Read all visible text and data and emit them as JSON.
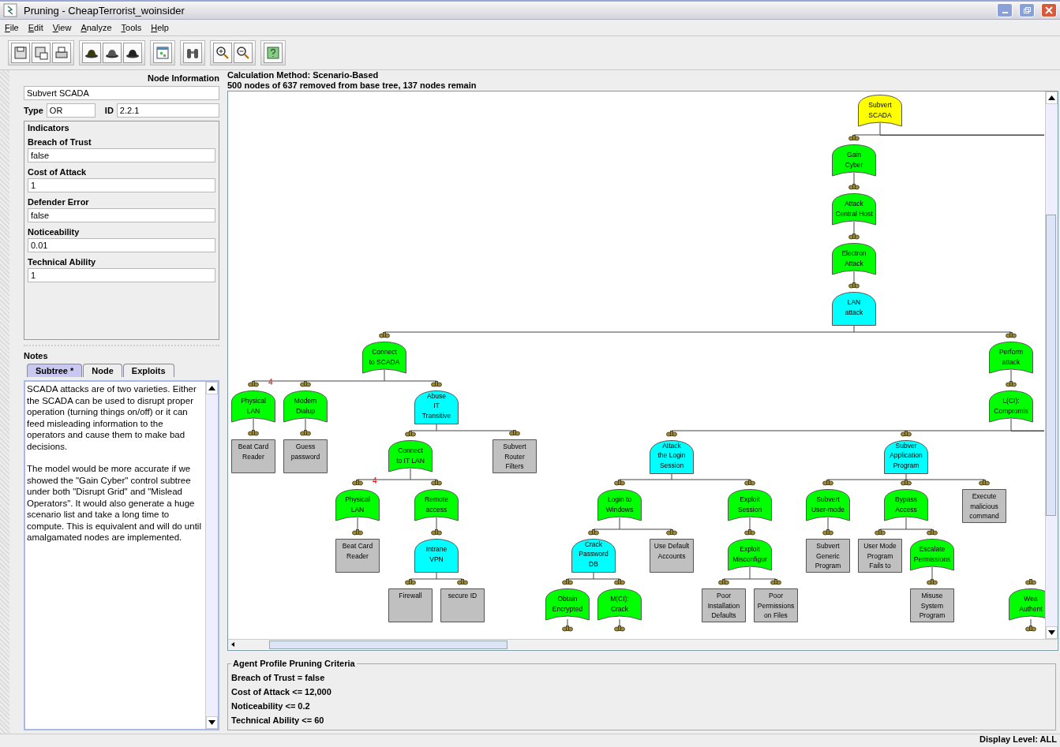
{
  "window": {
    "title": "Pruning - CheapTerrorist_woinsider"
  },
  "menu": [
    "File",
    "Edit",
    "View",
    "Analyze",
    "Tools",
    "Help"
  ],
  "node_info": {
    "title": "Node Information",
    "name": "Subvert SCADA",
    "type_label": "Type",
    "type": "OR",
    "id_label": "ID",
    "id": "2.2.1",
    "indicators_title": "Indicators",
    "indicators": [
      {
        "label": "Breach of Trust",
        "value": "false"
      },
      {
        "label": "Cost of Attack",
        "value": "1"
      },
      {
        "label": "Defender Error",
        "value": "false"
      },
      {
        "label": "Noticeability",
        "value": "0.01"
      },
      {
        "label": "Technical Ability",
        "value": "1"
      }
    ]
  },
  "notes": {
    "title": "Notes",
    "tabs": [
      {
        "label": "Subtree *",
        "selected": true
      },
      {
        "label": "Node",
        "selected": false
      },
      {
        "label": "Exploits",
        "selected": false
      }
    ],
    "paragraphs": [
      "SCADA attacks are of two varieties. Either the SCADA can be used to disrupt proper operation (turning things on/off) or it can feed misleading information to the operators and cause them to make bad decisions.",
      "The model would be more accurate if we showed the \"Gain Cyber\" control subtree under both \"Disrupt Grid\" and \"Mislead Operators\".  It would also generate a huge scenario list and take a long time to compute.  This is equivalent and will do until amalgamated nodes are implemented."
    ]
  },
  "calculation_method": "Calculation Method: Scenario-Based",
  "summary": "500 nodes of 637 removed from base tree, 137 nodes remain",
  "tree": {
    "lines": [
      "Subvert",
      "SCADA"
    ],
    "kind": "or",
    "selected": true,
    "more_right": true,
    "children": [
      {
        "lines": [
          "Gain",
          "Cyber"
        ],
        "kind": "or",
        "children": [
          {
            "lines": [
              "Attack",
              "Central Host"
            ],
            "kind": "or",
            "children": [
              {
                "lines": [
                  "Electron",
                  "Attack"
                ],
                "kind": "or",
                "children": [
                  {
                    "lines": [
                      "LAN",
                      "attack"
                    ],
                    "kind": "and",
                    "children": [
                      {
                        "lines": [
                          "Connect",
                          "to SCADA"
                        ],
                        "kind": "or",
                        "children": [
                          {
                            "lines": [
                              "Physical",
                              "LAN"
                            ],
                            "kind": "or",
                            "badge": "4",
                            "children": [
                              {
                                "lines": [
                                  "Beat Card",
                                  "Reader"
                                ],
                                "kind": "leaf"
                              }
                            ]
                          },
                          {
                            "lines": [
                              "Modem",
                              "Dialup"
                            ],
                            "kind": "or",
                            "children": [
                              {
                                "lines": [
                                  "Guess",
                                  "password"
                                ],
                                "kind": "leaf"
                              }
                            ]
                          },
                          {
                            "lines": [
                              "Abuse",
                              "IT",
                              "Transitive"
                            ],
                            "kind": "and",
                            "children": [
                              {
                                "lines": [
                                  "Connect",
                                  "to IT LAN"
                                ],
                                "kind": "or",
                                "children": [
                                  {
                                    "lines": [
                                      "Physical",
                                      "LAN"
                                    ],
                                    "kind": "or",
                                    "badge": "4",
                                    "children": [
                                      {
                                        "lines": [
                                          "Beat Card",
                                          "Reader"
                                        ],
                                        "kind": "leaf"
                                      }
                                    ]
                                  },
                                  {
                                    "lines": [
                                      "Remote",
                                      "access"
                                    ],
                                    "kind": "or",
                                    "children": [
                                      {
                                        "lines": [
                                          "Intrane",
                                          "VPN"
                                        ],
                                        "kind": "and",
                                        "children": [
                                          {
                                            "lines": [
                                              "Firewall"
                                            ],
                                            "kind": "leaf"
                                          },
                                          {
                                            "lines": [
                                              "secure ID"
                                            ],
                                            "kind": "leaf"
                                          }
                                        ]
                                      }
                                    ]
                                  }
                                ]
                              },
                              {
                                "lines": [
                                  "Subvert",
                                  "Router",
                                  "Filters"
                                ],
                                "kind": "leaf"
                              }
                            ]
                          }
                        ]
                      },
                      {
                        "lines": [
                          "Perform",
                          "attack"
                        ],
                        "kind": "or",
                        "children": [
                          {
                            "lines": [
                              "L(CI):",
                              "Compromis"
                            ],
                            "kind": "or",
                            "more_right": true,
                            "children": [
                              {
                                "lines": [
                                  "Attack",
                                  "the Login",
                                  "Session"
                                ],
                                "kind": "and",
                                "children": [
                                  {
                                    "lines": [
                                      "Login to",
                                      "Windows"
                                    ],
                                    "kind": "or",
                                    "children": [
                                      {
                                        "lines": [
                                          "Crack",
                                          "Password",
                                          "DB"
                                        ],
                                        "kind": "and",
                                        "children": [
                                          {
                                            "lines": [
                                              "Obtain",
                                              "Encrypted"
                                            ],
                                            "kind": "or",
                                            "more_below": true
                                          },
                                          {
                                            "lines": [
                                              "M(CI):",
                                              "Crack"
                                            ],
                                            "kind": "or",
                                            "more_below": true
                                          }
                                        ]
                                      },
                                      {
                                        "lines": [
                                          "Use Default",
                                          "Accounts"
                                        ],
                                        "kind": "leaf"
                                      }
                                    ]
                                  },
                                  {
                                    "lines": [
                                      "Exploit",
                                      "Session"
                                    ],
                                    "kind": "or",
                                    "children": [
                                      {
                                        "lines": [
                                          "Exploit",
                                          "Misconfigur"
                                        ],
                                        "kind": "or",
                                        "children": [
                                          {
                                            "lines": [
                                              "Poor",
                                              "Installation",
                                              "Defaults"
                                            ],
                                            "kind": "leaf"
                                          },
                                          {
                                            "lines": [
                                              "Poor",
                                              "Permissions",
                                              "on Files"
                                            ],
                                            "kind": "leaf"
                                          }
                                        ]
                                      }
                                    ]
                                  }
                                ]
                              },
                              {
                                "lines": [
                                  "Subver",
                                  "Application",
                                  "Program"
                                ],
                                "kind": "and",
                                "children": [
                                  {
                                    "lines": [
                                      "Subvert",
                                      "User-mode"
                                    ],
                                    "kind": "or",
                                    "children": [
                                      {
                                        "lines": [
                                          "Subvert",
                                          "Generic",
                                          "Program"
                                        ],
                                        "kind": "leaf"
                                      }
                                    ]
                                  },
                                  {
                                    "lines": [
                                      "Bypass",
                                      "Access"
                                    ],
                                    "kind": "or",
                                    "children": [
                                      {
                                        "lines": [
                                          "User Mode",
                                          "Program",
                                          "Fails to"
                                        ],
                                        "kind": "leaf"
                                      },
                                      {
                                        "lines": [
                                          "Escalate",
                                          "Permissions"
                                        ],
                                        "kind": "or",
                                        "children": [
                                          {
                                            "lines": [
                                              "Misuse",
                                              "System",
                                              "Program"
                                            ],
                                            "kind": "leaf"
                                          }
                                        ]
                                      }
                                    ]
                                  },
                                  {
                                    "lines": [
                                      "Execute",
                                      "malicious",
                                      "command"
                                    ],
                                    "kind": "leaf"
                                  }
                                ]
                              }
                            ]
                          }
                        ]
                      }
                    ]
                  }
                ]
              }
            ]
          }
        ]
      }
    ]
  },
  "partial_nodes": [
    {
      "lines": [
        "Wea",
        "Authent"
      ],
      "kind": "or",
      "more_below": true
    }
  ],
  "criteria": {
    "title": "Agent Profile Pruning Criteria",
    "items": [
      "Breach of Trust = false",
      "Cost of Attack <= 12,000",
      "Noticeability <= 0.2",
      "Technical Ability <= 60"
    ]
  },
  "status_bar": "Display Level: ALL"
}
